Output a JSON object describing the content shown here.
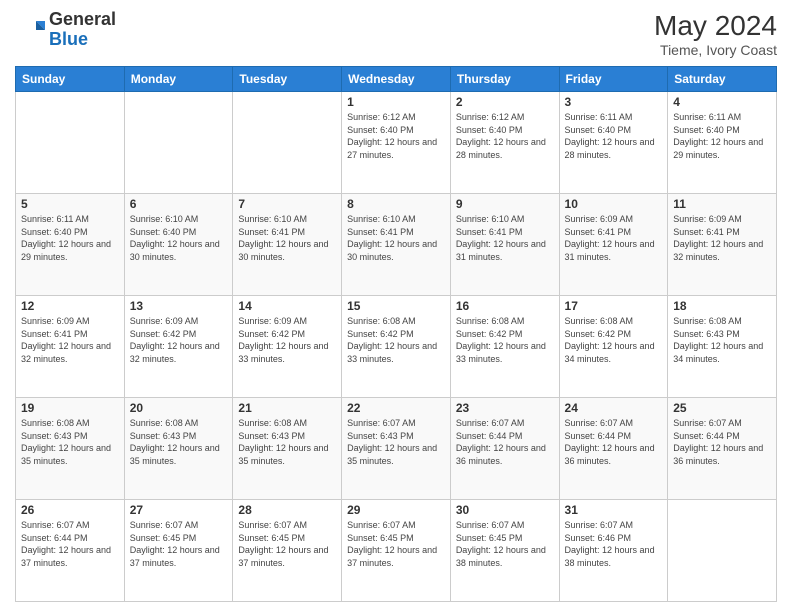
{
  "header": {
    "logo_general": "General",
    "logo_blue": "Blue",
    "month_title": "May 2024",
    "location": "Tieme, Ivory Coast"
  },
  "days_of_week": [
    "Sunday",
    "Monday",
    "Tuesday",
    "Wednesday",
    "Thursday",
    "Friday",
    "Saturday"
  ],
  "weeks": [
    [
      {
        "day": "",
        "info": ""
      },
      {
        "day": "",
        "info": ""
      },
      {
        "day": "",
        "info": ""
      },
      {
        "day": "1",
        "info": "Sunrise: 6:12 AM\nSunset: 6:40 PM\nDaylight: 12 hours\nand 27 minutes."
      },
      {
        "day": "2",
        "info": "Sunrise: 6:12 AM\nSunset: 6:40 PM\nDaylight: 12 hours\nand 28 minutes."
      },
      {
        "day": "3",
        "info": "Sunrise: 6:11 AM\nSunset: 6:40 PM\nDaylight: 12 hours\nand 28 minutes."
      },
      {
        "day": "4",
        "info": "Sunrise: 6:11 AM\nSunset: 6:40 PM\nDaylight: 12 hours\nand 29 minutes."
      }
    ],
    [
      {
        "day": "5",
        "info": "Sunrise: 6:11 AM\nSunset: 6:40 PM\nDaylight: 12 hours\nand 29 minutes."
      },
      {
        "day": "6",
        "info": "Sunrise: 6:10 AM\nSunset: 6:40 PM\nDaylight: 12 hours\nand 30 minutes."
      },
      {
        "day": "7",
        "info": "Sunrise: 6:10 AM\nSunset: 6:41 PM\nDaylight: 12 hours\nand 30 minutes."
      },
      {
        "day": "8",
        "info": "Sunrise: 6:10 AM\nSunset: 6:41 PM\nDaylight: 12 hours\nand 30 minutes."
      },
      {
        "day": "9",
        "info": "Sunrise: 6:10 AM\nSunset: 6:41 PM\nDaylight: 12 hours\nand 31 minutes."
      },
      {
        "day": "10",
        "info": "Sunrise: 6:09 AM\nSunset: 6:41 PM\nDaylight: 12 hours\nand 31 minutes."
      },
      {
        "day": "11",
        "info": "Sunrise: 6:09 AM\nSunset: 6:41 PM\nDaylight: 12 hours\nand 32 minutes."
      }
    ],
    [
      {
        "day": "12",
        "info": "Sunrise: 6:09 AM\nSunset: 6:41 PM\nDaylight: 12 hours\nand 32 minutes."
      },
      {
        "day": "13",
        "info": "Sunrise: 6:09 AM\nSunset: 6:42 PM\nDaylight: 12 hours\nand 32 minutes."
      },
      {
        "day": "14",
        "info": "Sunrise: 6:09 AM\nSunset: 6:42 PM\nDaylight: 12 hours\nand 33 minutes."
      },
      {
        "day": "15",
        "info": "Sunrise: 6:08 AM\nSunset: 6:42 PM\nDaylight: 12 hours\nand 33 minutes."
      },
      {
        "day": "16",
        "info": "Sunrise: 6:08 AM\nSunset: 6:42 PM\nDaylight: 12 hours\nand 33 minutes."
      },
      {
        "day": "17",
        "info": "Sunrise: 6:08 AM\nSunset: 6:42 PM\nDaylight: 12 hours\nand 34 minutes."
      },
      {
        "day": "18",
        "info": "Sunrise: 6:08 AM\nSunset: 6:43 PM\nDaylight: 12 hours\nand 34 minutes."
      }
    ],
    [
      {
        "day": "19",
        "info": "Sunrise: 6:08 AM\nSunset: 6:43 PM\nDaylight: 12 hours\nand 35 minutes."
      },
      {
        "day": "20",
        "info": "Sunrise: 6:08 AM\nSunset: 6:43 PM\nDaylight: 12 hours\nand 35 minutes."
      },
      {
        "day": "21",
        "info": "Sunrise: 6:08 AM\nSunset: 6:43 PM\nDaylight: 12 hours\nand 35 minutes."
      },
      {
        "day": "22",
        "info": "Sunrise: 6:07 AM\nSunset: 6:43 PM\nDaylight: 12 hours\nand 35 minutes."
      },
      {
        "day": "23",
        "info": "Sunrise: 6:07 AM\nSunset: 6:44 PM\nDaylight: 12 hours\nand 36 minutes."
      },
      {
        "day": "24",
        "info": "Sunrise: 6:07 AM\nSunset: 6:44 PM\nDaylight: 12 hours\nand 36 minutes."
      },
      {
        "day": "25",
        "info": "Sunrise: 6:07 AM\nSunset: 6:44 PM\nDaylight: 12 hours\nand 36 minutes."
      }
    ],
    [
      {
        "day": "26",
        "info": "Sunrise: 6:07 AM\nSunset: 6:44 PM\nDaylight: 12 hours\nand 37 minutes."
      },
      {
        "day": "27",
        "info": "Sunrise: 6:07 AM\nSunset: 6:45 PM\nDaylight: 12 hours\nand 37 minutes."
      },
      {
        "day": "28",
        "info": "Sunrise: 6:07 AM\nSunset: 6:45 PM\nDaylight: 12 hours\nand 37 minutes."
      },
      {
        "day": "29",
        "info": "Sunrise: 6:07 AM\nSunset: 6:45 PM\nDaylight: 12 hours\nand 37 minutes."
      },
      {
        "day": "30",
        "info": "Sunrise: 6:07 AM\nSunset: 6:45 PM\nDaylight: 12 hours\nand 38 minutes."
      },
      {
        "day": "31",
        "info": "Sunrise: 6:07 AM\nSunset: 6:46 PM\nDaylight: 12 hours\nand 38 minutes."
      },
      {
        "day": "",
        "info": ""
      }
    ]
  ]
}
